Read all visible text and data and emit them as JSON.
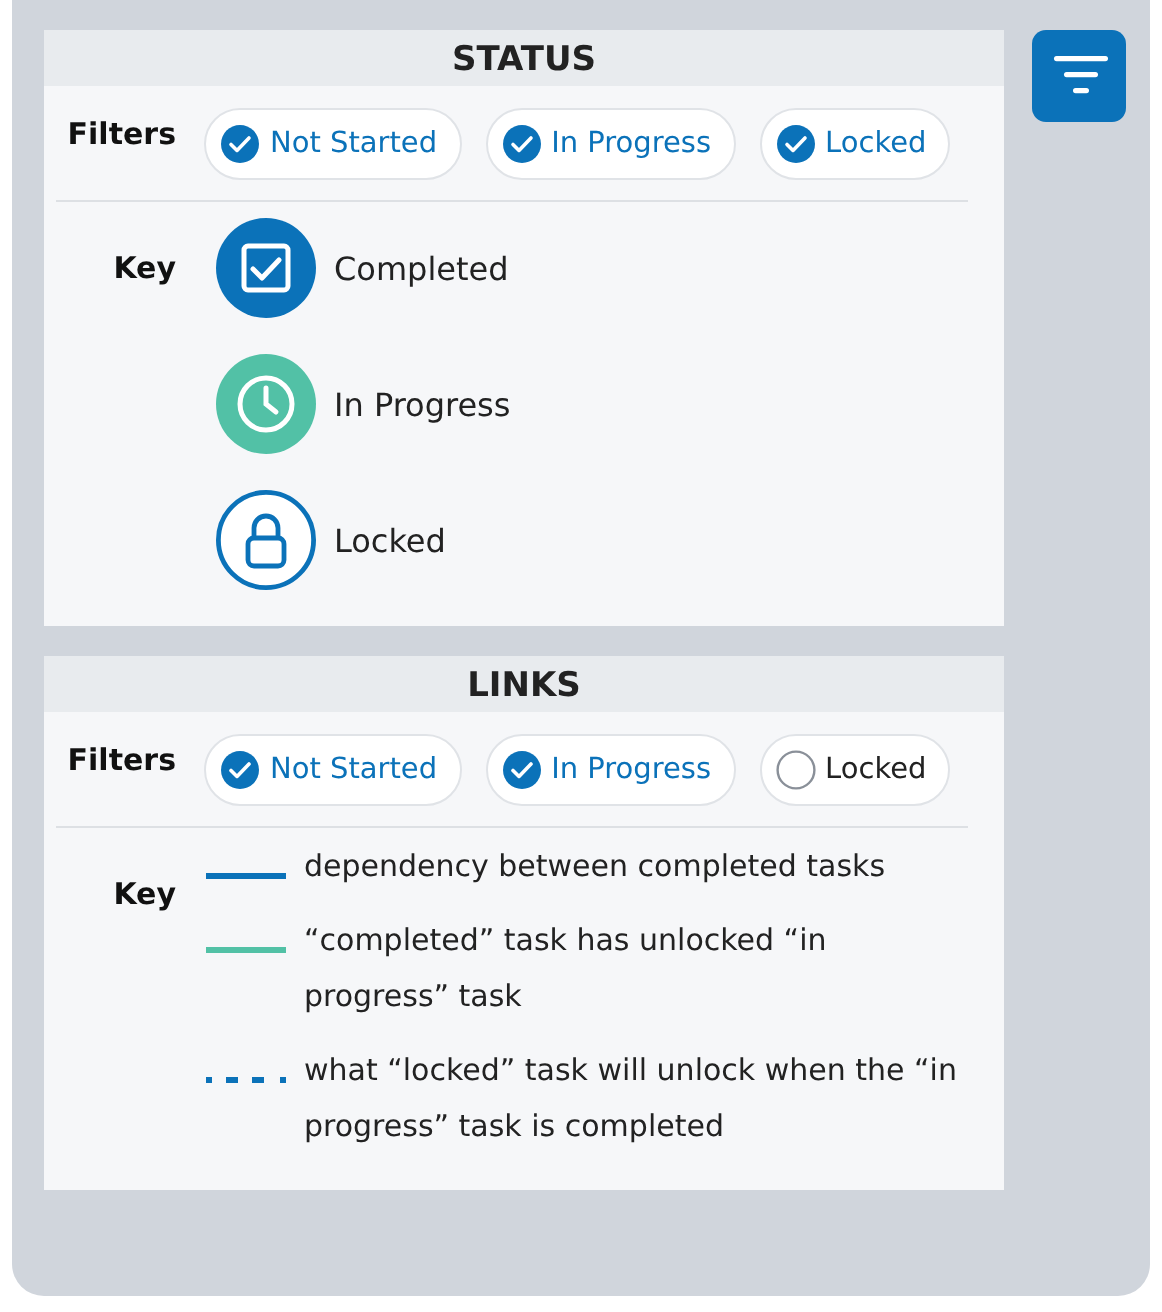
{
  "sections": [
    {
      "title": "STATUS",
      "filters_label": "Filters",
      "filters": [
        {
          "label": "Not Started",
          "checked": true
        },
        {
          "label": "In Progress",
          "checked": true
        },
        {
          "label": "Locked",
          "checked": true
        }
      ],
      "key_label": "Key",
      "key": [
        {
          "kind": "completed",
          "label": "Completed"
        },
        {
          "kind": "in_progress",
          "label": "In Progress"
        },
        {
          "kind": "locked",
          "label": "Locked"
        }
      ]
    },
    {
      "title": "LINKS",
      "filters_label": "Filters",
      "filters": [
        {
          "label": "Not Started",
          "checked": true
        },
        {
          "label": "In Progress",
          "checked": true
        },
        {
          "label": "Locked",
          "checked": false
        }
      ],
      "key_label": "Key",
      "key": [
        {
          "kind": "solid_line",
          "color": "#0b72b9",
          "label": "dependency between completed tasks"
        },
        {
          "kind": "solid_line",
          "color": "#52c1a6",
          "label": "“completed” task has unlocked “in progress” task"
        },
        {
          "kind": "dashed_line",
          "color": "#0b72b9",
          "label": "what “locked” task will unlock when the “in progress” task is completed"
        }
      ]
    }
  ]
}
